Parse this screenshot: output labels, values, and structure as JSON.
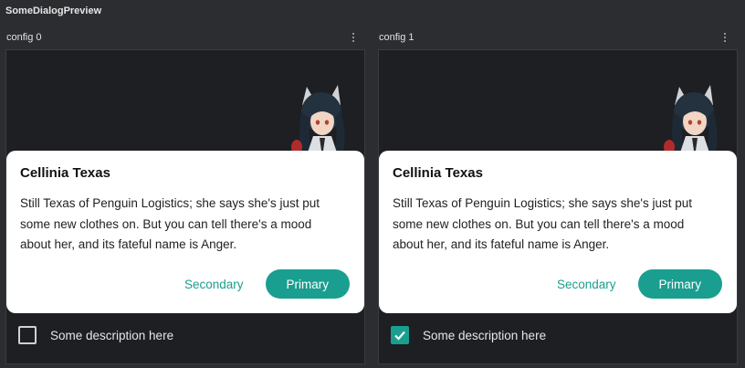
{
  "preview": {
    "title": "SomeDialogPreview"
  },
  "colors": {
    "accent": "#1a9e8f",
    "background": "#2b2d30",
    "device": "#1e1f22"
  },
  "configs": [
    {
      "label": "config 0",
      "dialog": {
        "title": "Cellinia Texas",
        "body": "Still Texas of Penguin Logistics; she says she's just put some new clothes on. But you can tell there's a mood about her, and its fateful name is Anger.",
        "secondary_label": "Secondary",
        "primary_label": "Primary"
      },
      "checkbox": {
        "label": "Some description here",
        "checked": false
      }
    },
    {
      "label": "config 1",
      "dialog": {
        "title": "Cellinia Texas",
        "body": "Still Texas of Penguin Logistics; she says she's just put some new clothes on. But you can tell there's a mood about her, and its fateful name is Anger.",
        "secondary_label": "Secondary",
        "primary_label": "Primary"
      },
      "checkbox": {
        "label": "Some description here",
        "checked": true
      }
    }
  ]
}
